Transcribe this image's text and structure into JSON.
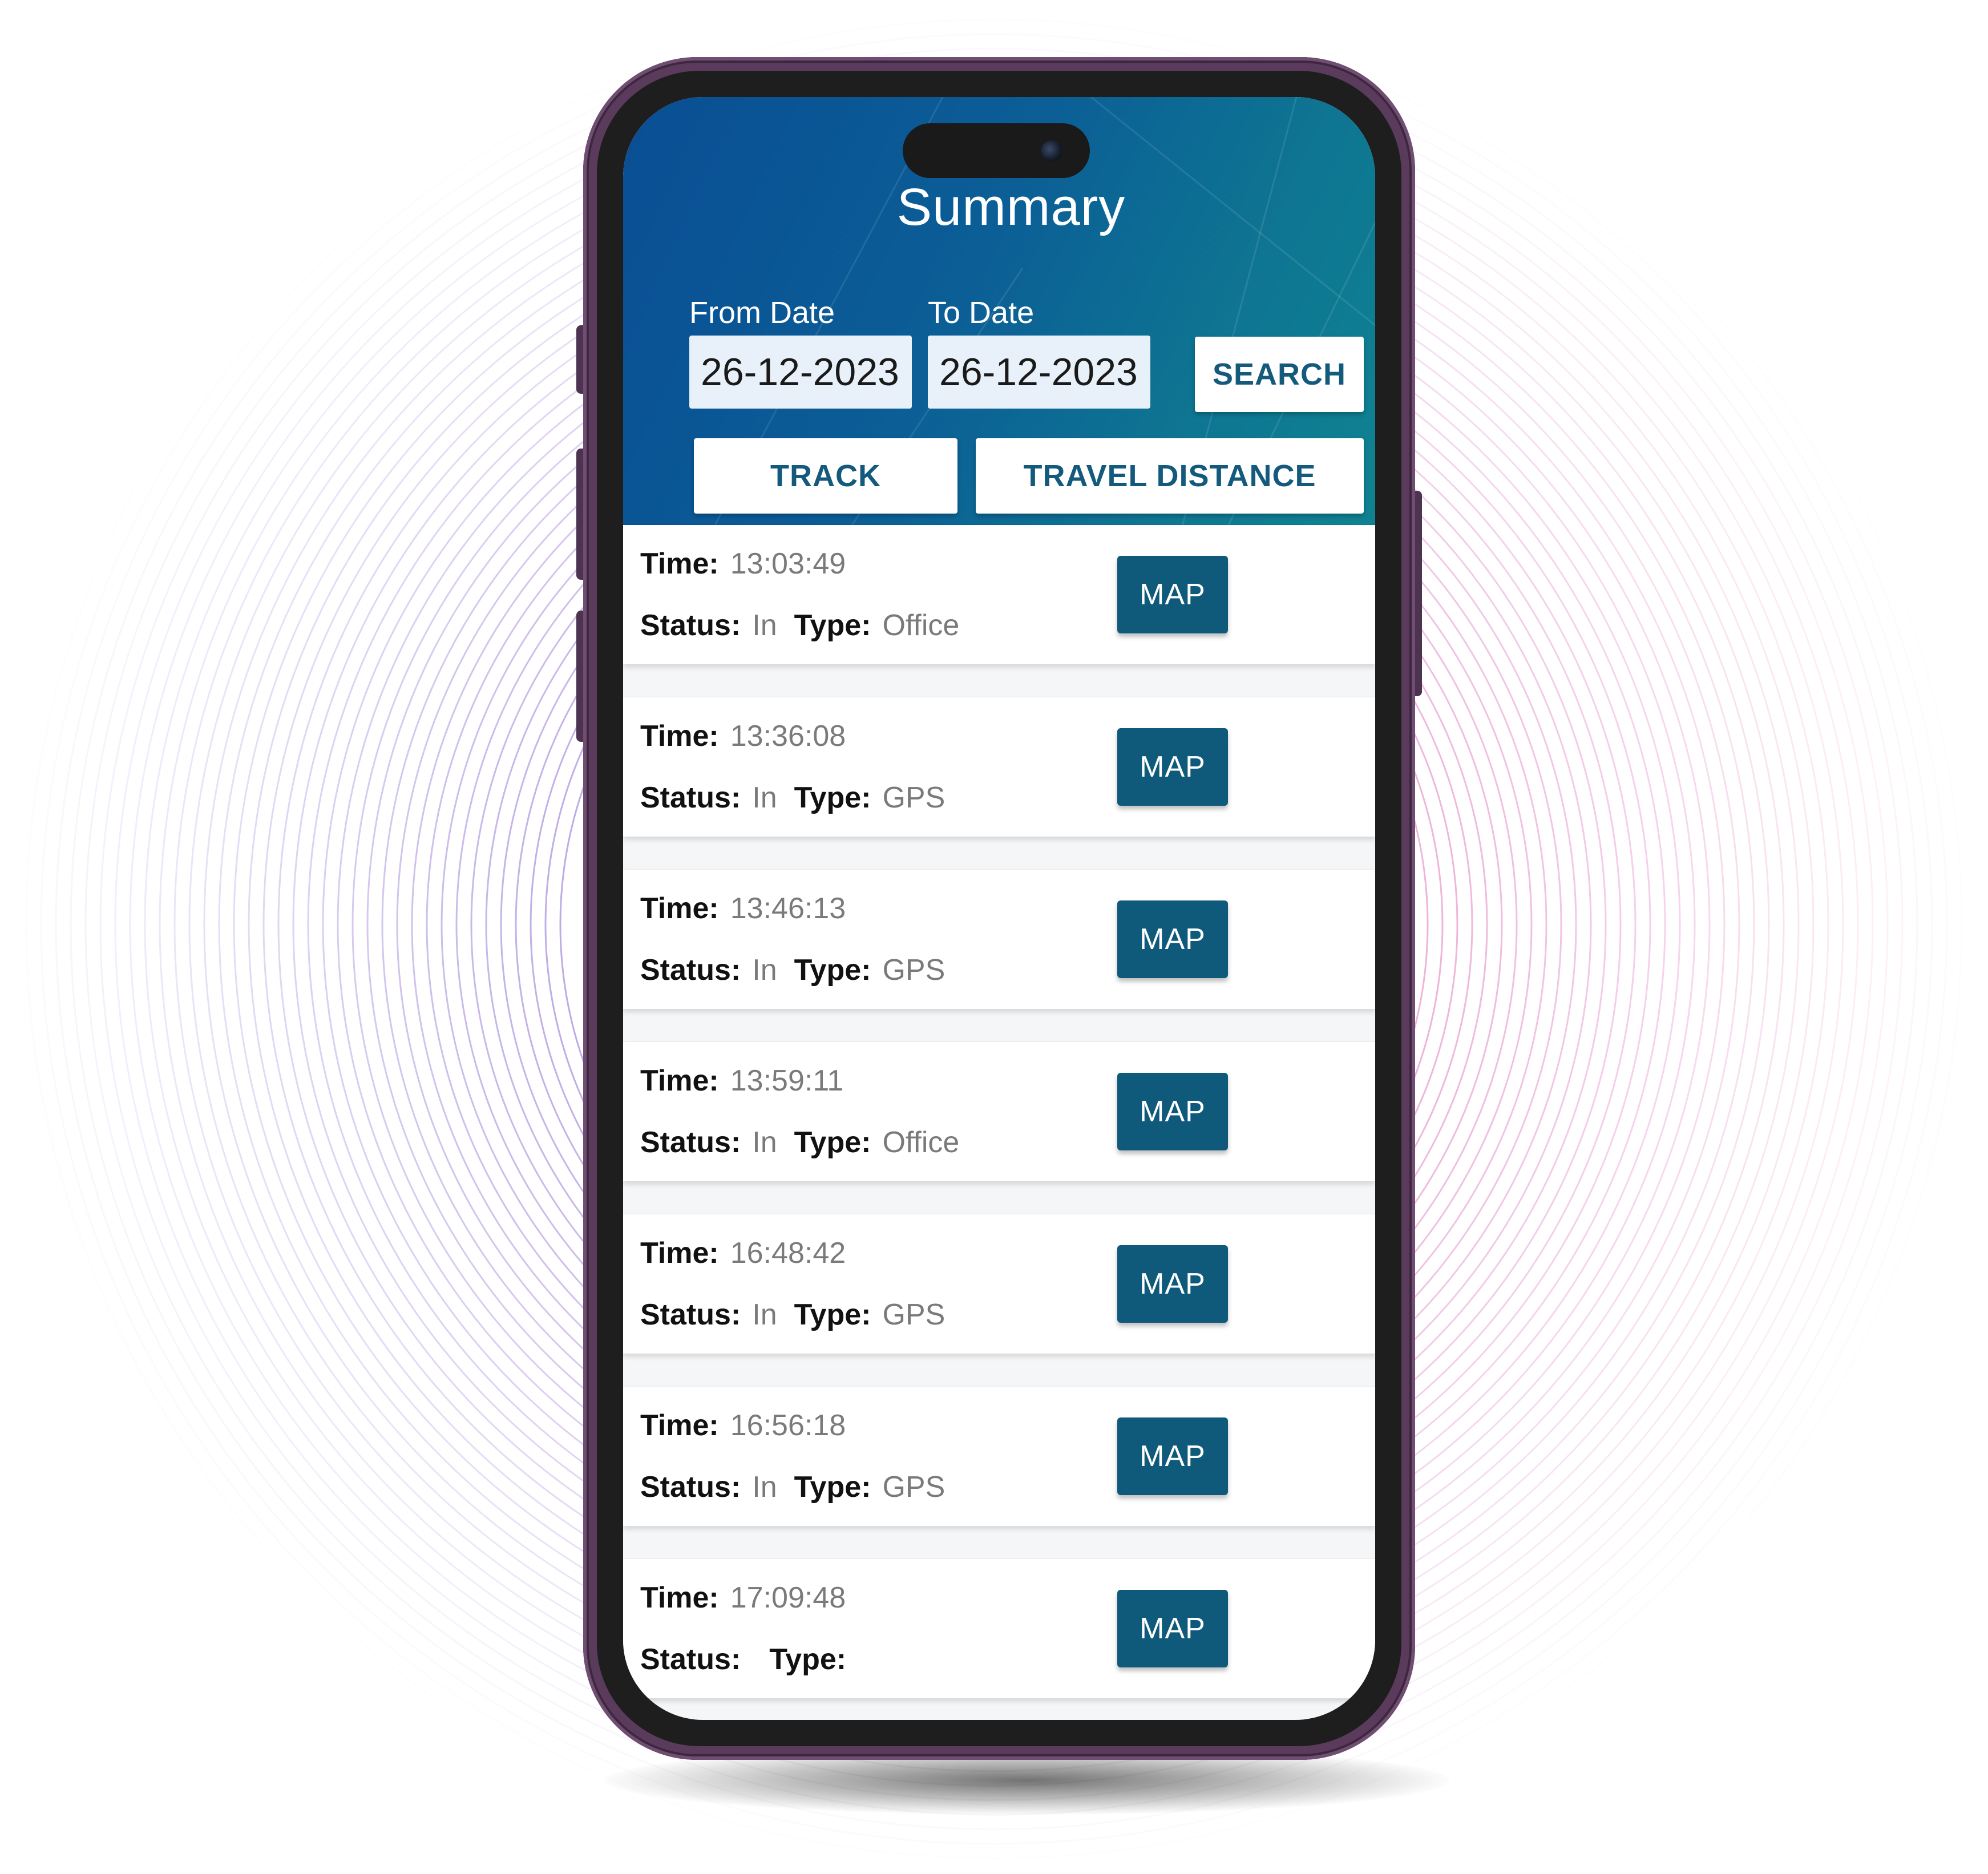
{
  "app": {
    "title": "Summary"
  },
  "filters": {
    "from_label": "From Date",
    "from_value": "26-12-2023",
    "to_label": "To Date",
    "to_value": "26-12-2023",
    "search_label": "SEARCH"
  },
  "actions": {
    "track_label": "TRACK",
    "travel_distance_label": "TRAVEL DISTANCE"
  },
  "labels": {
    "time": "Time:",
    "status": "Status:",
    "type": "Type:",
    "map": "MAP"
  },
  "records": [
    {
      "time": "13:03:49",
      "status": "In",
      "type": "Office"
    },
    {
      "time": "13:36:08",
      "status": "In",
      "type": "GPS"
    },
    {
      "time": "13:46:13",
      "status": "In",
      "type": "GPS"
    },
    {
      "time": "13:59:11",
      "status": "In",
      "type": "Office"
    },
    {
      "time": "16:48:42",
      "status": "In",
      "type": "GPS"
    },
    {
      "time": "16:56:18",
      "status": "In",
      "type": "GPS"
    },
    {
      "time": "17:09:48",
      "status": "",
      "type": ""
    }
  ],
  "colors": {
    "header_start": "#0a4e94",
    "header_end": "#0f8391",
    "accent": "#0f5a7a",
    "phone_frame": "#5a3b5c"
  }
}
